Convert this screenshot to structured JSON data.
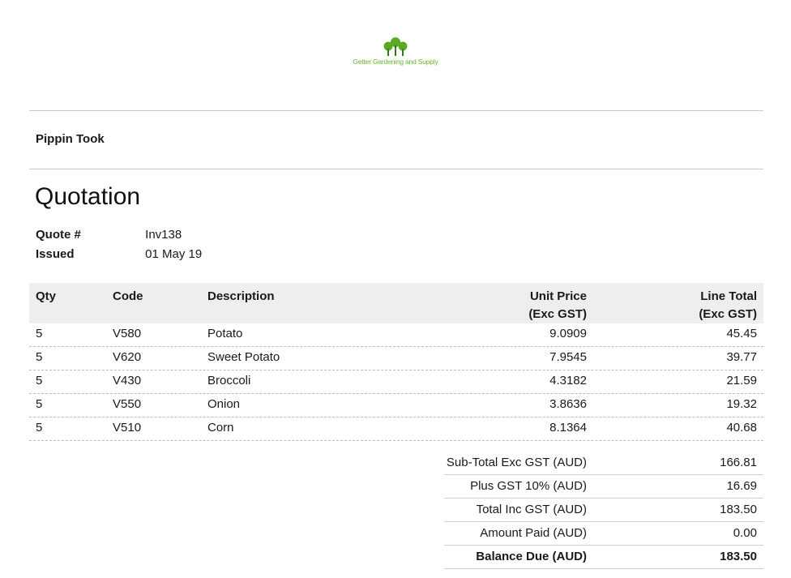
{
  "company": {
    "logo_text": "Getter Gardening and Supply",
    "brand_color": "#5aaa22"
  },
  "customer": {
    "name": "Pippin Took"
  },
  "document": {
    "title": "Quotation",
    "meta": [
      {
        "label": "Quote #",
        "value": "Inv138"
      },
      {
        "label": "Issued",
        "value": "01 May 19"
      }
    ]
  },
  "table": {
    "headers": {
      "qty": "Qty",
      "code": "Code",
      "description": "Description",
      "unit_price_1": "Unit Price",
      "unit_price_2": "(Exc GST)",
      "line_total_1": "Line Total",
      "line_total_2": "(Exc GST)"
    },
    "rows": [
      {
        "qty": "5",
        "code": "V580",
        "description": "Potato",
        "unit_price": "9.0909",
        "line_total": "45.45"
      },
      {
        "qty": "5",
        "code": "V620",
        "description": "Sweet Potato",
        "unit_price": "7.9545",
        "line_total": "39.77"
      },
      {
        "qty": "5",
        "code": "V430",
        "description": "Broccoli",
        "unit_price": "4.3182",
        "line_total": "21.59"
      },
      {
        "qty": "5",
        "code": "V550",
        "description": "Onion",
        "unit_price": "3.8636",
        "line_total": "19.32"
      },
      {
        "qty": "5",
        "code": "V510",
        "description": "Corn",
        "unit_price": "8.1364",
        "line_total": "40.68"
      }
    ]
  },
  "totals": [
    {
      "label": "Sub-Total Exc GST (AUD)",
      "value": "166.81"
    },
    {
      "label": "Plus GST 10% (AUD)",
      "value": "16.69"
    },
    {
      "label": "Total Inc GST (AUD)",
      "value": "183.50"
    },
    {
      "label": "Amount Paid (AUD)",
      "value": "0.00"
    },
    {
      "label": "Balance Due (AUD)",
      "value": "183.50"
    }
  ]
}
